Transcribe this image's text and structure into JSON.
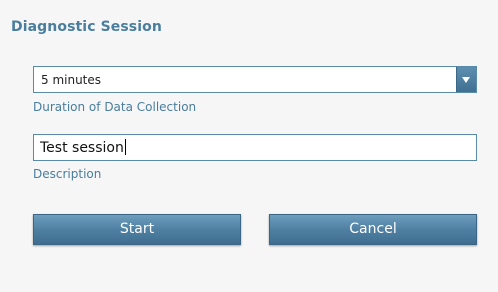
{
  "dialog": {
    "title": "Diagnostic Session"
  },
  "duration": {
    "selected": "5 minutes",
    "caption": "Duration of Data Collection",
    "dropdown_icon": "chevron-down-icon"
  },
  "description": {
    "value": "Test session",
    "caption": "Description"
  },
  "buttons": {
    "start": "Start",
    "cancel": "Cancel"
  },
  "colors": {
    "accent": "#4a7d9e",
    "button": "#4f80a2",
    "border": "#5a8aa9"
  }
}
